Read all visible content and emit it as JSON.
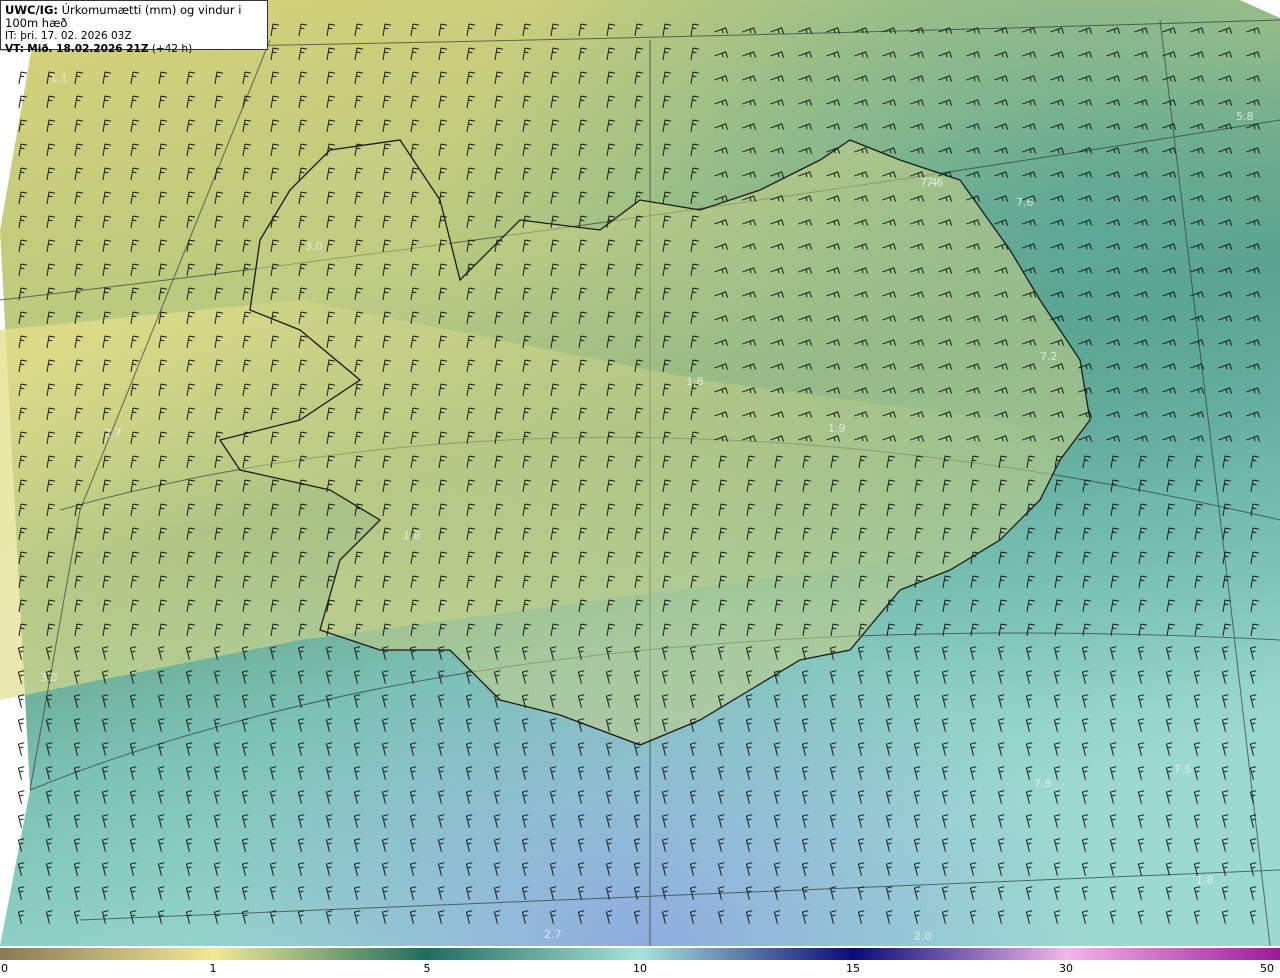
{
  "header": {
    "model": "UWC/IG:",
    "title": "Úrkomumætti (mm) og vindur i 100m hæð",
    "it_label": "IT:",
    "it_value": "þri. 17. 02. 2026 03Z",
    "vt_label": "VT:",
    "vt_value": "Mið. 18.02.2026 21Z",
    "vt_offset": "(+42 h)"
  },
  "map_values": [
    "1.1",
    "5.8",
    "3.0",
    "7.6",
    "7.6",
    "7.2",
    "1.8",
    "1.9",
    "2.7",
    "1.8",
    "3.0",
    "7.9",
    "7.5",
    "2.7",
    "2.0",
    "1.8",
    "7.4"
  ],
  "legend": {
    "ticks": [
      "0",
      "1",
      "5",
      "10",
      "15",
      "30",
      "50"
    ],
    "colors": [
      "#8a7a55",
      "#f2e896",
      "#1f6e5d",
      "#a9e3da",
      "#0a0a7a",
      "#f2b6e8",
      "#9b1a9b"
    ]
  }
}
